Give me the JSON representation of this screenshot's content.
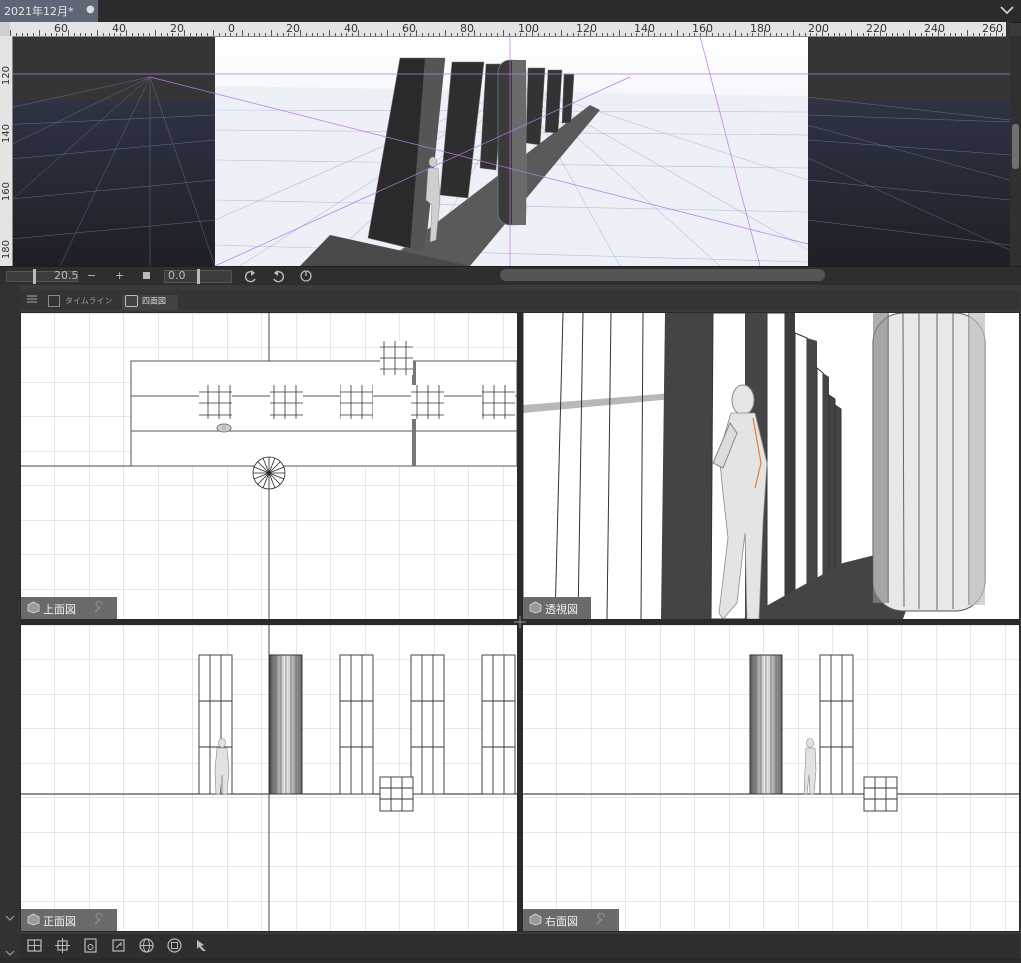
{
  "document_tab": {
    "title": "2021年12月*",
    "close_symbol": "●"
  },
  "rulers": {
    "top_ticks": [
      "60",
      "40",
      "20",
      "0",
      "20",
      "40",
      "60",
      "80",
      "100",
      "120",
      "140",
      "160",
      "180",
      "200",
      "220",
      "240",
      "260"
    ],
    "left_ticks": [
      "120",
      "140",
      "160",
      "180"
    ]
  },
  "canvas_toolbar": {
    "zoom": "20.5",
    "zoom_out": "−",
    "zoom_in": "+",
    "rotation": "0.0"
  },
  "panel": {
    "timeline_tab": "タイムライン",
    "four_view_tab": "四面図"
  },
  "views": {
    "top": {
      "label": "上面図"
    },
    "perspective": {
      "label": "透視図"
    },
    "front": {
      "label": "正面図"
    },
    "right": {
      "label": "右面図"
    }
  },
  "bottom_tools": [
    "layout-icon",
    "center-icon",
    "camera-icon",
    "light-icon",
    "sphere-icon",
    "target-icon",
    "pin-icon"
  ],
  "colors": {
    "tab_active": "#5f6776",
    "panel_bg": "#3a3a3a",
    "label_bg": "#6a6a6a",
    "guide": "#9b59d0"
  }
}
